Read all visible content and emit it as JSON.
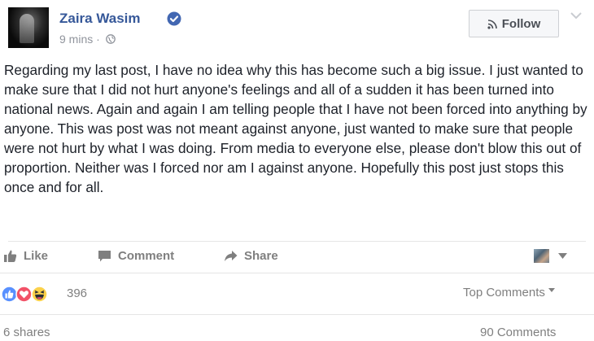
{
  "post": {
    "author_name": "Zaira Wasim",
    "timestamp": "9 mins",
    "meta_separator": "·",
    "follow_label": "Follow",
    "body_text": "Regarding my last post, I have no idea why this has become such a big issue. I just wanted to make sure that I did not hurt anyone's feelings and all of a sudden it has been turned into national news. Again and again I am telling people that I have not been forced into anything by anyone. This was post was not meant against anyone, just wanted to make sure that people were not hurt by what I was doing. From media to everyone else, please don't blow this out of proportion. Neither was I forced nor am I against anyone. Hopefully this post just stops this once and for all."
  },
  "actions": {
    "like_label": "Like",
    "comment_label": "Comment",
    "share_label": "Share"
  },
  "reactions": {
    "count": "396",
    "types": [
      "like",
      "love",
      "haha"
    ],
    "top_comments_label": "Top Comments"
  },
  "stats": {
    "shares": "6 shares",
    "comments": "90 Comments"
  },
  "colors": {
    "link_blue": "#365899",
    "verified_blue": "#4267b2",
    "love_red": "#f25268",
    "haha_yellow": "#fbd14b",
    "muted_gray": "#7f7f7f"
  },
  "icons": {
    "verified": "verified-badge-icon",
    "globe": "globe-icon",
    "follow": "rss-icon",
    "menu": "chevron-down-icon",
    "like": "thumbs-up-icon",
    "comment": "comment-bubble-icon",
    "share": "share-arrow-icon"
  }
}
